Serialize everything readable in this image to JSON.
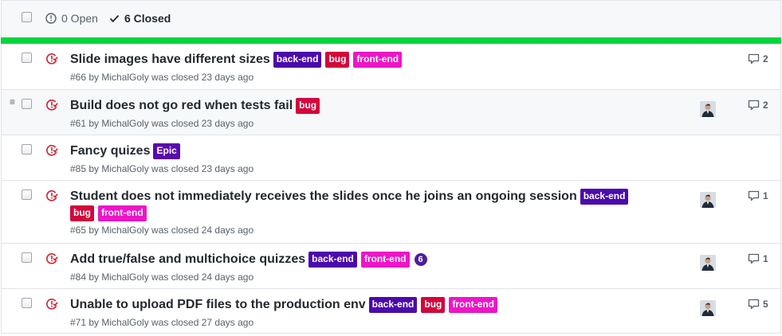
{
  "header": {
    "open_label": "0 Open",
    "closed_label": "6 Closed"
  },
  "colors": {
    "back-end": "#4b0aad",
    "bug": "#d4063b",
    "front-end": "#ee15c8",
    "Epic": "#5a0aad",
    "progress": "#00d640",
    "closed_icon": "#cb2431"
  },
  "issues": [
    {
      "title": "Slide images have different sizes",
      "labels": [
        "back-end",
        "bug",
        "front-end"
      ],
      "meta": "#66 by MichalGoly was closed 23 days ago",
      "comments": "2",
      "has_avatar": false
    },
    {
      "title": "Build does not go red when tests fail",
      "labels": [
        "bug"
      ],
      "meta": "#61 by MichalGoly was closed 23 days ago",
      "comments": "2",
      "has_avatar": true
    },
    {
      "title": "Fancy quizes",
      "labels": [
        "Epic"
      ],
      "meta": "#85 by MichalGoly was closed 23 days ago",
      "comments": "",
      "has_avatar": false
    },
    {
      "title": "Student does not immediately receives the slides once he joins an ongoing session",
      "labels": [
        "back-end",
        "bug",
        "front-end"
      ],
      "meta": "#65 by MichalGoly was closed 24 days ago",
      "comments": "1",
      "has_avatar": true
    },
    {
      "title": "Add true/false and multichoice quizzes",
      "labels": [
        "back-end",
        "front-end"
      ],
      "task_count": "6",
      "meta": "#84 by MichalGoly was closed 24 days ago",
      "comments": "1",
      "has_avatar": true
    },
    {
      "title": "Unable to upload PDF files to the production env",
      "labels": [
        "back-end",
        "bug",
        "front-end"
      ],
      "meta": "#71 by MichalGoly was closed 27 days ago",
      "comments": "5",
      "has_avatar": true
    }
  ]
}
